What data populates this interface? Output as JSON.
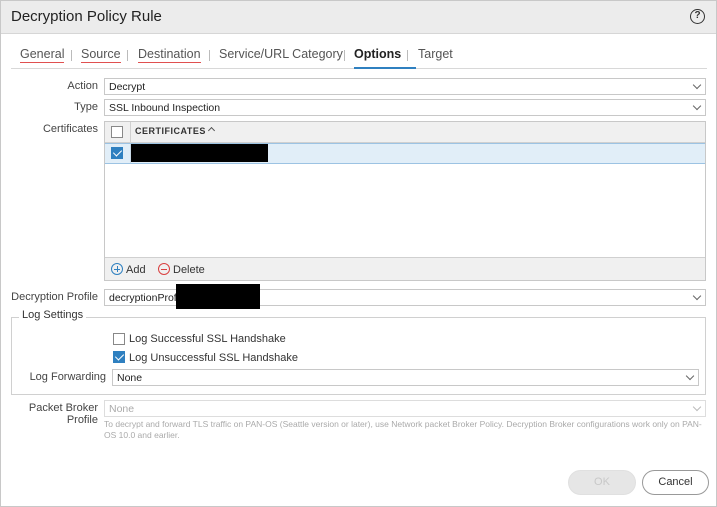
{
  "dialog": {
    "title": "Decryption Policy Rule",
    "help_icon": "question-circle-icon",
    "help_glyph": "?"
  },
  "tabs": [
    {
      "label": "General"
    },
    {
      "label": "Source"
    },
    {
      "label": "Destination"
    },
    {
      "label": "Service/URL Category"
    },
    {
      "label": "Options"
    },
    {
      "label": "Target"
    }
  ],
  "active_tab": "Options",
  "options": {
    "action": {
      "label": "Action",
      "value": "Decrypt"
    },
    "type": {
      "label": "Type",
      "value": "SSL Inbound Inspection"
    },
    "certificates": {
      "label": "Certificates",
      "column_header": "CERTIFICATES",
      "sort": "ascending",
      "rows": [
        {
          "checked": true,
          "value": "[redacted]"
        }
      ],
      "add_label": "Add",
      "delete_label": "Delete"
    },
    "decryption_profile": {
      "label": "Decryption Profile",
      "value": "decryptionProfi"
    },
    "log_settings": {
      "legend": "Log Settings",
      "log_successful": {
        "label": "Log Successful SSL Handshake",
        "checked": false
      },
      "log_unsuccessful": {
        "label": "Log Unsuccessful SSL Handshake",
        "checked": true
      },
      "log_forwarding": {
        "label": "Log Forwarding",
        "value": "None"
      }
    },
    "packet_broker": {
      "label_line1": "Packet Broker",
      "label_line2": "Profile",
      "value": "None",
      "disabled": true,
      "help_text": "To decrypt and forward TLS traffic on PAN-OS (Seattle version or later), use Network packet Broker Policy. Decryption Broker configurations work only on PAN-OS 10.0 and earlier."
    }
  },
  "footer": {
    "ok_label": "OK",
    "ok_disabled": true,
    "cancel_label": "Cancel"
  },
  "colors": {
    "accent": "#2f80c0",
    "tab_error_underline": "#e05050",
    "delete_red": "#d94040"
  }
}
